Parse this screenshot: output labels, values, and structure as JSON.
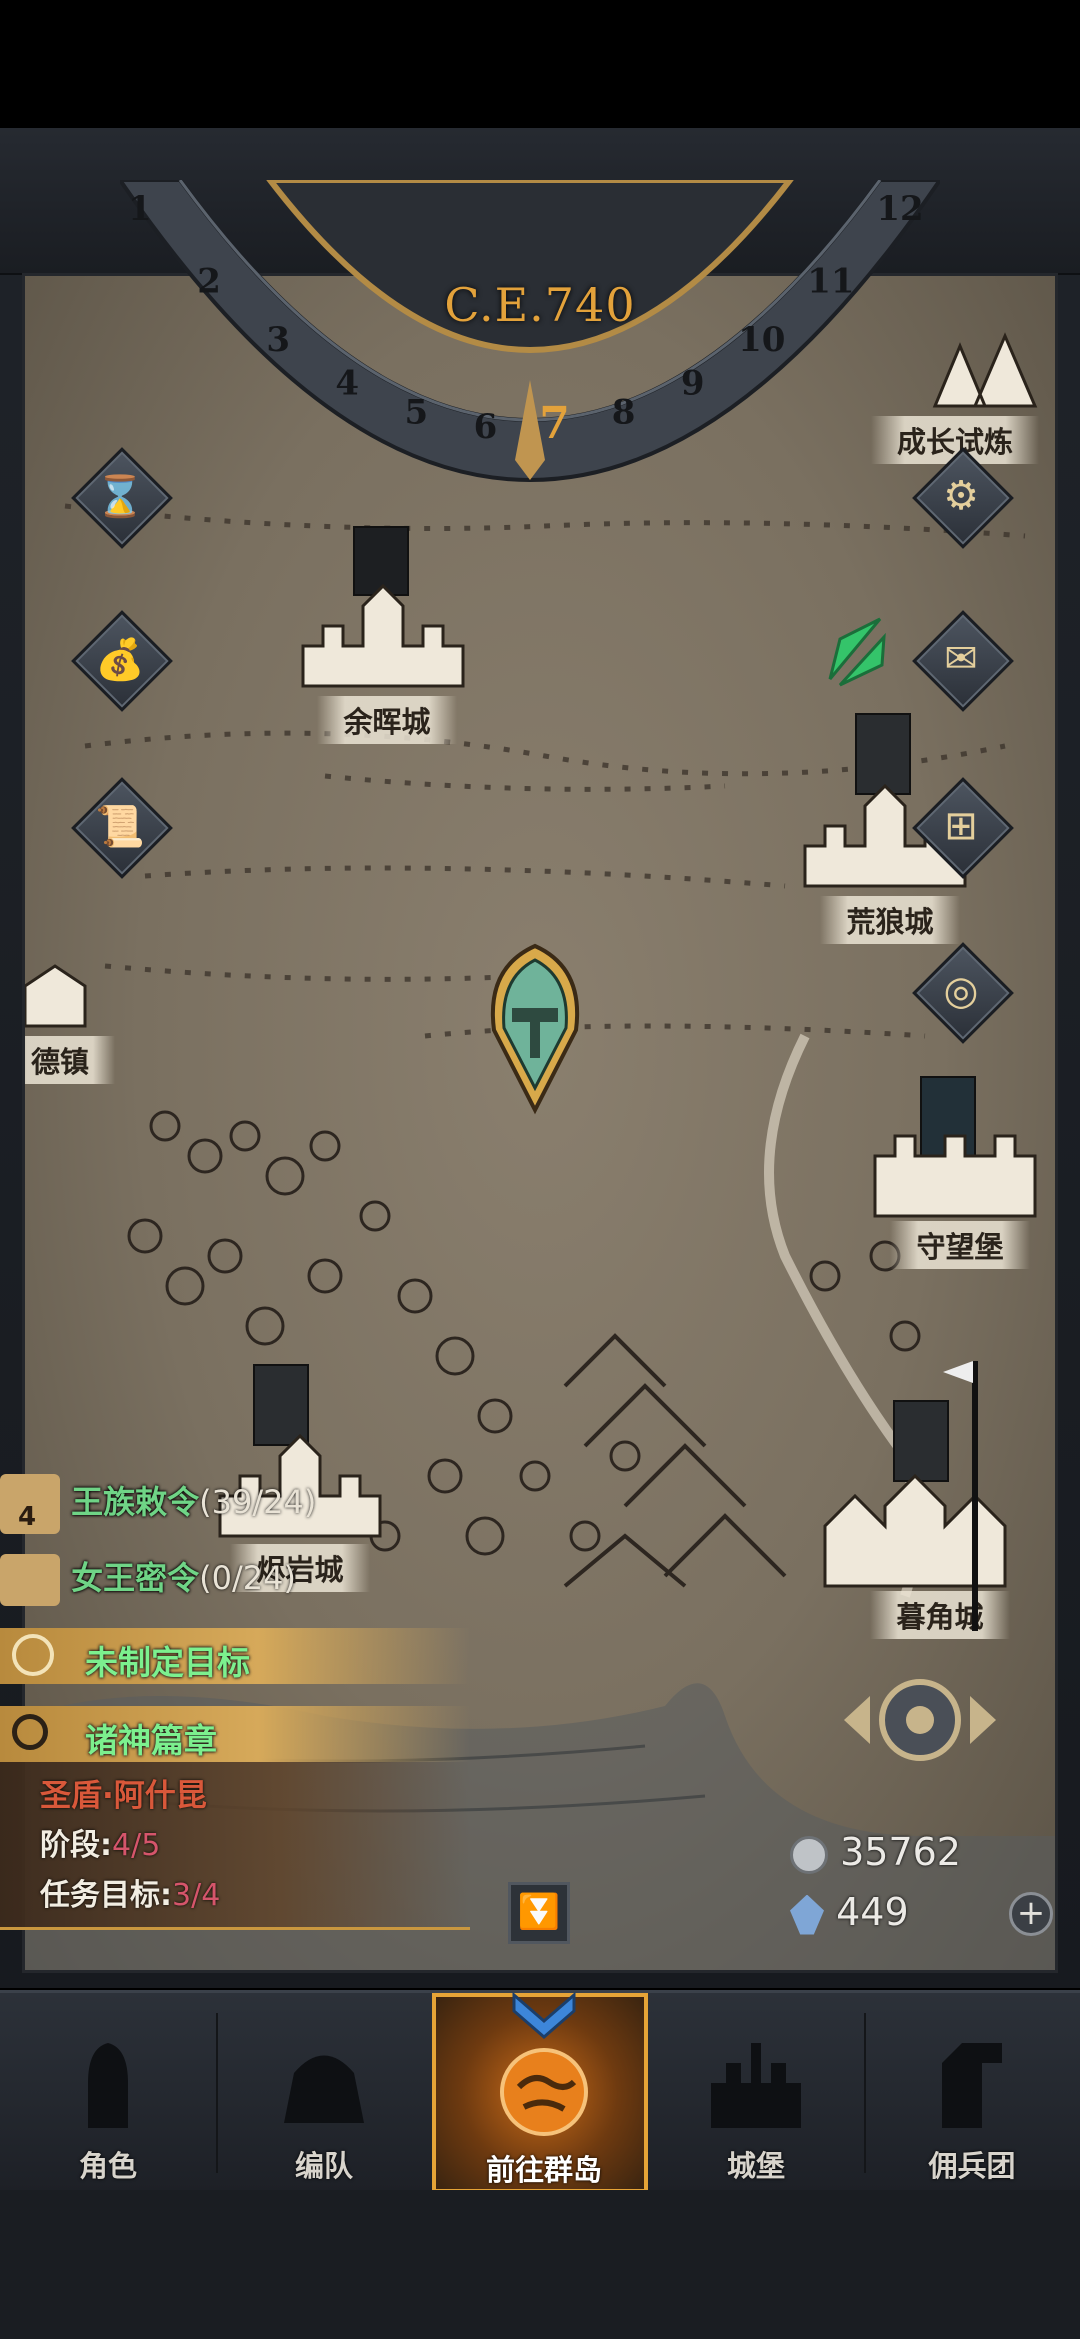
{
  "era": "C.E.740",
  "calendar": {
    "months": [
      "1",
      "2",
      "3",
      "4",
      "5",
      "6",
      "7",
      "8",
      "9",
      "10",
      "11",
      "12"
    ],
    "current_month": "7"
  },
  "cities": {
    "yuhui": "余晖城",
    "huanglang": "荒狼城",
    "shouwang": "守望堡",
    "muxiao": "暮角城",
    "jiaoyan": "烬岩城",
    "de_zhen": "德镇",
    "chengzhang": "成长试炼"
  },
  "quests": {
    "royal_decree": {
      "label": "王族敕令",
      "count": "(39/24)"
    },
    "queen_secret": {
      "label": "女王密令",
      "count": "(0/24)"
    },
    "royal_badge": "4",
    "goal_unset": "未制定目标",
    "gods_chapter": "诸神篇章",
    "hero": "圣盾·阿什昆",
    "stage_label": "阶段:",
    "stage_value": "4/5",
    "task_label": "任务目标:",
    "task_value": "3/4"
  },
  "resources": {
    "silver": "35762",
    "crystal": "449"
  },
  "nav": {
    "character": "角色",
    "team": "编队",
    "islands": "前往群岛",
    "castle": "城堡",
    "mercenary": "佣兵团"
  },
  "colors": {
    "accent": "#e3a23b",
    "quest_green": "#6fd486",
    "highlight_red": "#d5556b"
  }
}
